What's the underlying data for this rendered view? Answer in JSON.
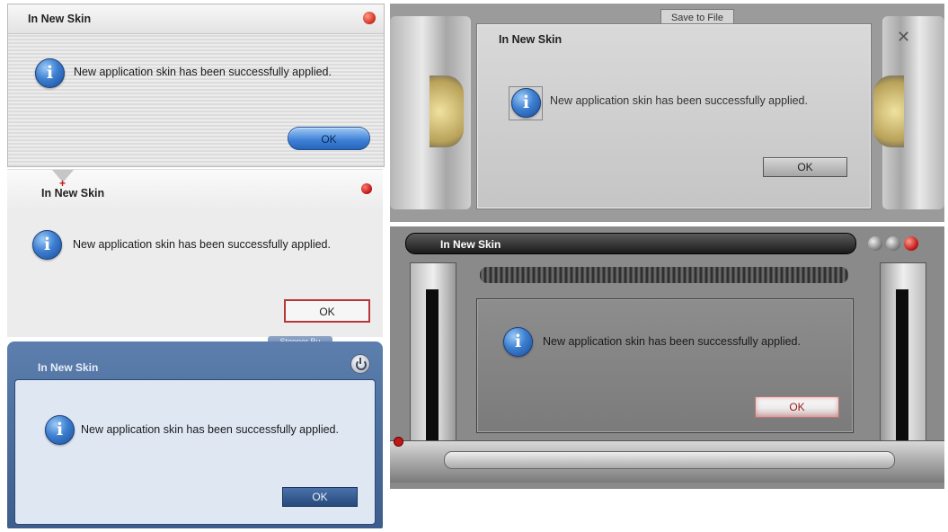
{
  "dialog": {
    "title": "In New Skin",
    "message": "New application skin has been successfully applied.",
    "ok_label": "OK",
    "info_glyph": "i"
  },
  "background": {
    "save_label": "Save to File",
    "stepper_label": "Stepper Bu"
  },
  "colors": {
    "blue_button": "#3c7fd6",
    "red_accent": "#cc2222",
    "dark_blue": "#2c4d80",
    "metal_gray": "#8a8a8a"
  },
  "icons": [
    "info-icon",
    "close-icon",
    "power-icon",
    "window-control-icon"
  ]
}
